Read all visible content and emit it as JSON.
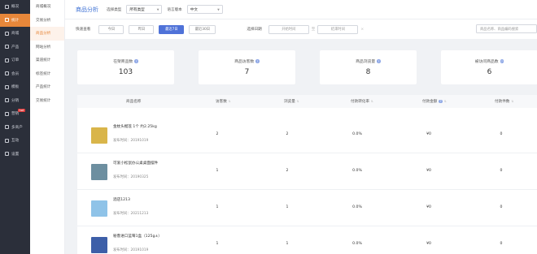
{
  "sidebar": {
    "items": [
      {
        "label": "概况"
      },
      {
        "label": "统计"
      },
      {
        "label": "商城"
      },
      {
        "label": "产品"
      },
      {
        "label": "订单"
      },
      {
        "label": "会员"
      },
      {
        "label": "模板"
      },
      {
        "label": "分销"
      },
      {
        "label": "营销",
        "badge": "hot"
      },
      {
        "label": "多商户"
      },
      {
        "label": "互动"
      },
      {
        "label": "设置"
      }
    ]
  },
  "subnav": {
    "items": [
      {
        "label": "商城概况"
      },
      {
        "label": "交易分析"
      },
      {
        "label": "商品分析"
      },
      {
        "label": "网站分析"
      },
      {
        "label": "渠道统计"
      },
      {
        "label": "标签统计"
      },
      {
        "label": "产品统计"
      },
      {
        "label": "交易统计"
      }
    ]
  },
  "header": {
    "title": "商品分析",
    "type_label": "选择类型",
    "type_value": "所有类型",
    "lang_label": "语言版本",
    "lang_value": "中文"
  },
  "filter": {
    "quick_label": "快速查看",
    "buttons": [
      "今日",
      "昨日",
      "最近7日",
      "最近30日"
    ],
    "date_label": "选择日期",
    "start_placeholder": "开始时间",
    "end_placeholder": "结束时间",
    "date_sep": "至",
    "search_placeholder": "商品名称、商品编码搜索"
  },
  "stats": [
    {
      "label": "在架商品数",
      "value": "103"
    },
    {
      "label": "商品访客数",
      "value": "7"
    },
    {
      "label": "商品浏览量",
      "value": "8"
    },
    {
      "label": "被访问商品数",
      "value": "6"
    }
  ],
  "table": {
    "columns": [
      "商品名称",
      "访客数",
      "浏览量",
      "付款转化率",
      "付款金额",
      "付款件数"
    ],
    "time_prefix": "发布时间：",
    "rows": [
      {
        "name": "金枕头榴莲 1个 约2.25kg",
        "time": "20191019",
        "visitors": "2",
        "views": "2",
        "rate": "0.0%",
        "amount": "¥0",
        "qty": "0",
        "thumb_color": "#d9b54a"
      },
      {
        "name": "可爱小松鼠办公桌桌面摆件",
        "time": "20190325",
        "visitors": "1",
        "views": "2",
        "rate": "0.0%",
        "amount": "¥0",
        "qty": "0",
        "thumb_color": "#6d8fa0"
      },
      {
        "name": "酒店1213",
        "time": "20211213",
        "visitors": "1",
        "views": "1",
        "rate": "0.0%",
        "amount": "¥0",
        "qty": "0",
        "thumb_color": "#8fc3e8"
      },
      {
        "name": "秘鲁进口蓝莓1盒（125g±）",
        "time": "20191019",
        "visitors": "1",
        "views": "1",
        "rate": "0.0%",
        "amount": "¥0",
        "qty": "0",
        "thumb_color": "#3d5fa8"
      }
    ]
  },
  "colors": {
    "accent_orange": "#e7873a",
    "accent_blue": "#4f72d8",
    "sidebar_bg": "#2b2f3a"
  }
}
